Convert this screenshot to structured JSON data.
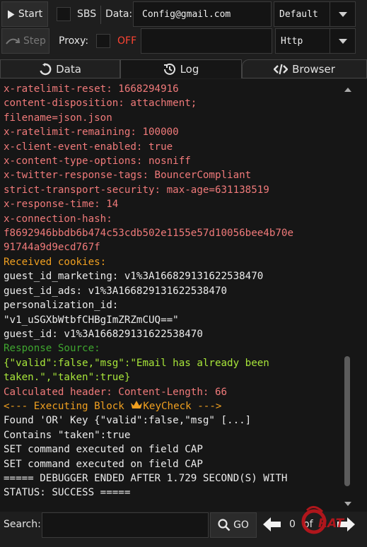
{
  "toolbar": {
    "start_label": "Start",
    "sbs_label": "SBS",
    "data_label": "Data:",
    "data_value": "Config@gmail.com",
    "wordlist_type": "Default",
    "step_label": "Step",
    "proxy_label": "Proxy:",
    "proxy_status": "OFF",
    "proxy_value": "",
    "proxy_type": "Http"
  },
  "tabs": [
    {
      "label": "Data",
      "icon": "refresh-icon"
    },
    {
      "label": "Log",
      "icon": "history-icon"
    },
    {
      "label": "Browser",
      "icon": "code-icon"
    }
  ],
  "log_lines": [
    {
      "text": "x-ratelimit-reset: 1668294916",
      "color": "red"
    },
    {
      "text": "content-disposition: attachment;",
      "color": "red"
    },
    {
      "text": "filename=json.json",
      "color": "red"
    },
    {
      "text": "x-ratelimit-remaining: 100000",
      "color": "red"
    },
    {
      "text": "x-client-event-enabled: true",
      "color": "red"
    },
    {
      "text": "x-content-type-options: nosniff",
      "color": "red"
    },
    {
      "text": "x-twitter-response-tags: BouncerCompliant",
      "color": "red"
    },
    {
      "text": "strict-transport-security: max-age=631138519",
      "color": "red"
    },
    {
      "text": "x-response-time: 14",
      "color": "red"
    },
    {
      "text": "x-connection-hash:",
      "color": "red"
    },
    {
      "text": "f8692946bbdb6b474c53cdb502e1155e57d10056bee4b70e",
      "color": "red"
    },
    {
      "text": "91744a9d9ecd767f",
      "color": "red"
    },
    {
      "text": "Received cookies:",
      "color": "orange"
    },
    {
      "text": "guest_id_marketing: v1%3A166829131622538470",
      "color": "white"
    },
    {
      "text": "guest_id_ads: v1%3A166829131622538470",
      "color": "white"
    },
    {
      "text": "personalization_id:",
      "color": "white"
    },
    {
      "text": "\"v1_uSGXbWtbfCHBgImZRZmCUQ==\"",
      "color": "white"
    },
    {
      "text": "guest_id: v1%3A166829131622538470",
      "color": "white"
    },
    {
      "text": "Response Source:",
      "color": "green"
    },
    {
      "text": "{\"valid\":false,\"msg\":\"Email has already been",
      "color": "lime"
    },
    {
      "text": "taken.\",\"taken\":true}",
      "color": "lime"
    },
    {
      "text": "Calculated header: Content-Length: 66",
      "color": "red"
    },
    {
      "text": "<--- Executing Block ",
      "color": "orange",
      "crown": true,
      "after": "KeyCheck --->"
    },
    {
      "text": "Found 'OR' Key {\"valid\":false,\"msg\" [...]",
      "color": "white"
    },
    {
      "text": "Contains \"taken\":true",
      "color": "white"
    },
    {
      "text": "SET command executed on field CAP",
      "color": "white"
    },
    {
      "text": "SET command executed on field CAP",
      "color": "white"
    },
    {
      "text": "===== DEBUGGER ENDED AFTER 1.729 SECOND(S) WITH",
      "color": "white"
    },
    {
      "text": "STATUS: SUCCESS =====",
      "color": "white"
    }
  ],
  "bottom": {
    "search_label": "Search:",
    "search_value": "",
    "go_label": "GO",
    "match_count": "0",
    "match_of": "of",
    "watermark_text": "RAT"
  },
  "colors": {
    "red": "#f07a7a",
    "white": "#ececec",
    "orange": "#f0a020",
    "green": "#3fa62f",
    "lime": "#a8e63a",
    "proxy_off": "#ff4433",
    "watermark": "#c0161c"
  }
}
